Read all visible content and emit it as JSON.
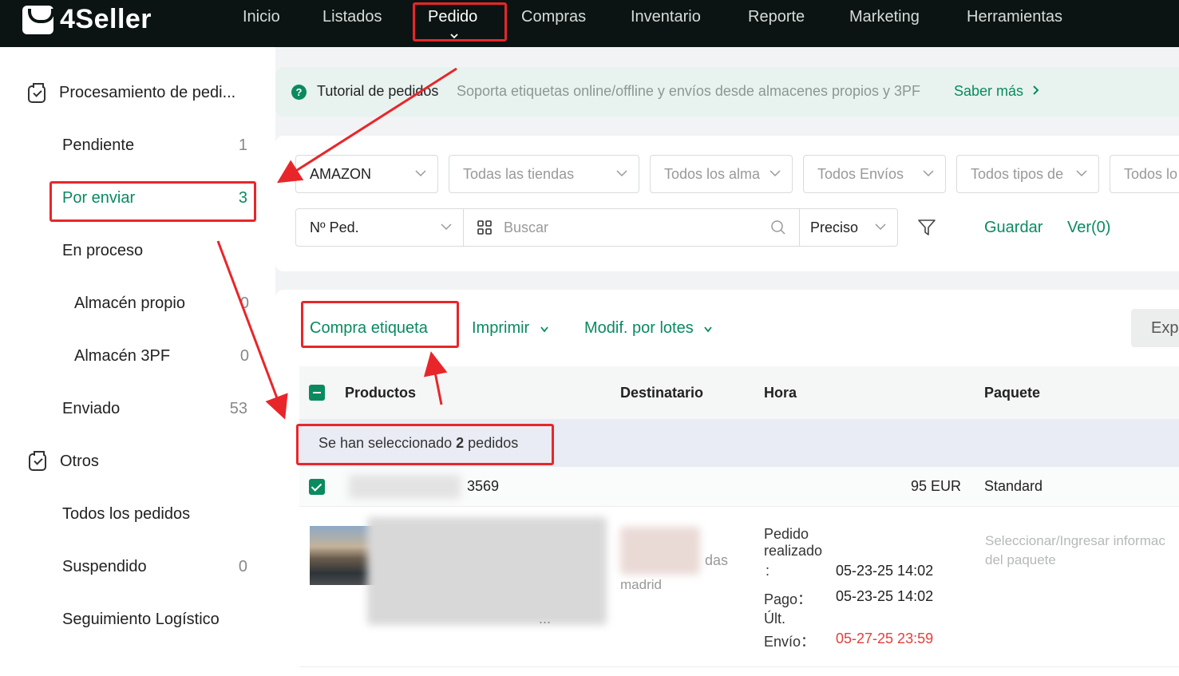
{
  "app": {
    "logo_text": "4Seller"
  },
  "nav": {
    "items": [
      "Inicio",
      "Listados",
      "Pedido",
      "Compras",
      "Inventario",
      "Reporte",
      "Marketing",
      "Herramientas"
    ],
    "active": "Pedido"
  },
  "sidebar": {
    "section1": "Procesamiento de pedi...",
    "pendiente": {
      "label": "Pendiente",
      "count": "1"
    },
    "por_enviar": {
      "label": "Por enviar",
      "count": "3"
    },
    "en_proceso": {
      "label": "En proceso"
    },
    "almacen_propio": {
      "label": "Almacén propio",
      "count": "0"
    },
    "almacen_3pf": {
      "label": "Almacén 3PF",
      "count": "0"
    },
    "enviado": {
      "label": "Enviado",
      "count": "53"
    },
    "section2": "Otros",
    "todos": {
      "label": "Todos los pedidos"
    },
    "suspendido": {
      "label": "Suspendido",
      "count": "0"
    },
    "seguimiento": {
      "label": "Seguimiento Logístico"
    }
  },
  "banner": {
    "title": "Tutorial de pedidos",
    "description": "Soporta etiquetas online/offline y envíos desde almacenes propios y 3PF",
    "link": "Saber más"
  },
  "filters": {
    "platform": "AMAZON",
    "stores": "Todas las tiendas",
    "warehouses": "Todos los alma",
    "shipping": "Todos Envíos",
    "types": "Todos tipos de",
    "others": "Todos lo",
    "field": "Nº Ped.",
    "search_placeholder": "Buscar",
    "match": "Preciso",
    "save": "Guardar",
    "view": "Ver(0)"
  },
  "toolbar": {
    "buy_label": "Compra etiqueta",
    "print": "Imprimir",
    "batch": "Modif. por lotes",
    "export": "Exp"
  },
  "table": {
    "headers": {
      "products": "Productos",
      "recipient": "Destinatario",
      "time": "Hora",
      "package": "Paquete"
    },
    "selection": {
      "prefix": "Se han seleccionado",
      "count": "2",
      "suffix": "pedidos"
    },
    "order": {
      "id_suffix": "3569",
      "amount": "95 EUR",
      "service": "Standard",
      "recipient_partial": "madrid",
      "recipient_partial2": "das",
      "ellipsis": "...",
      "placed_label_1": "Pedido",
      "placed_label_2": "realizado",
      "placed_colon": ":",
      "placed_value": "05-23-25 14:02",
      "paid_label": "Pago：",
      "paid_value": "05-23-25 14:02",
      "last_label_1": "Últ.",
      "last_label_2": "Envío：",
      "last_value": "05-27-25 23:59",
      "package_placeholder": "Seleccionar/Ingresar informac del paquete"
    }
  },
  "colors": {
    "brand": "#0a8a5f",
    "nav_bg": "#0b1412",
    "annotation": "#e8262a",
    "deadline": "#e0413c"
  }
}
